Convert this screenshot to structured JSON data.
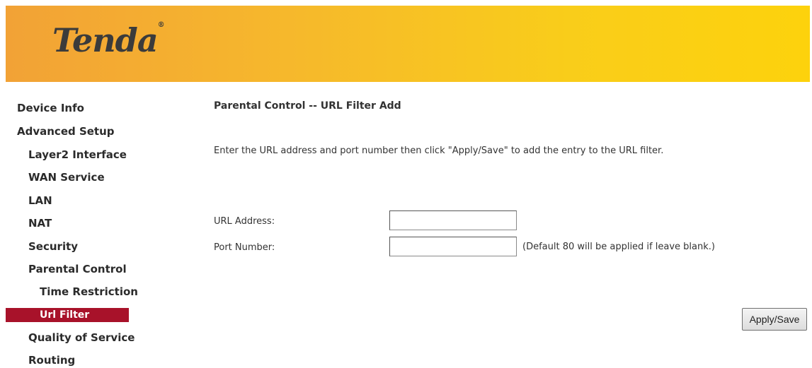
{
  "header": {
    "logo_text": "Tenda",
    "logo_mark": "®",
    "gradient_start": "#f2a236",
    "gradient_end": "#fdd20c"
  },
  "sidebar": {
    "active_color": "#a8122a",
    "items": [
      {
        "label": "Device Info",
        "level": 0,
        "active": false
      },
      {
        "label": "Advanced Setup",
        "level": 0,
        "active": false
      },
      {
        "label": "Layer2 Interface",
        "level": 1,
        "active": false
      },
      {
        "label": "WAN Service",
        "level": 1,
        "active": false
      },
      {
        "label": "LAN",
        "level": 1,
        "active": false
      },
      {
        "label": "NAT",
        "level": 1,
        "active": false
      },
      {
        "label": "Security",
        "level": 1,
        "active": false
      },
      {
        "label": "Parental Control",
        "level": 1,
        "active": false
      },
      {
        "label": "Time Restriction",
        "level": 2,
        "active": false
      },
      {
        "label": "Url Filter",
        "level": 2,
        "active": true
      },
      {
        "label": "Quality of Service",
        "level": 1,
        "active": false
      },
      {
        "label": "Routing",
        "level": 1,
        "active": false
      }
    ]
  },
  "main": {
    "title": "Parental Control -- URL Filter Add",
    "instructions": "Enter the URL address and port number then click \"Apply/Save\" to add the entry to the URL filter.",
    "url_label": "URL Address:",
    "url_value": "",
    "port_label": "Port Number:",
    "port_value": "",
    "port_hint": "(Default 80 will be applied if leave blank.)",
    "apply_label": "Apply/Save"
  }
}
